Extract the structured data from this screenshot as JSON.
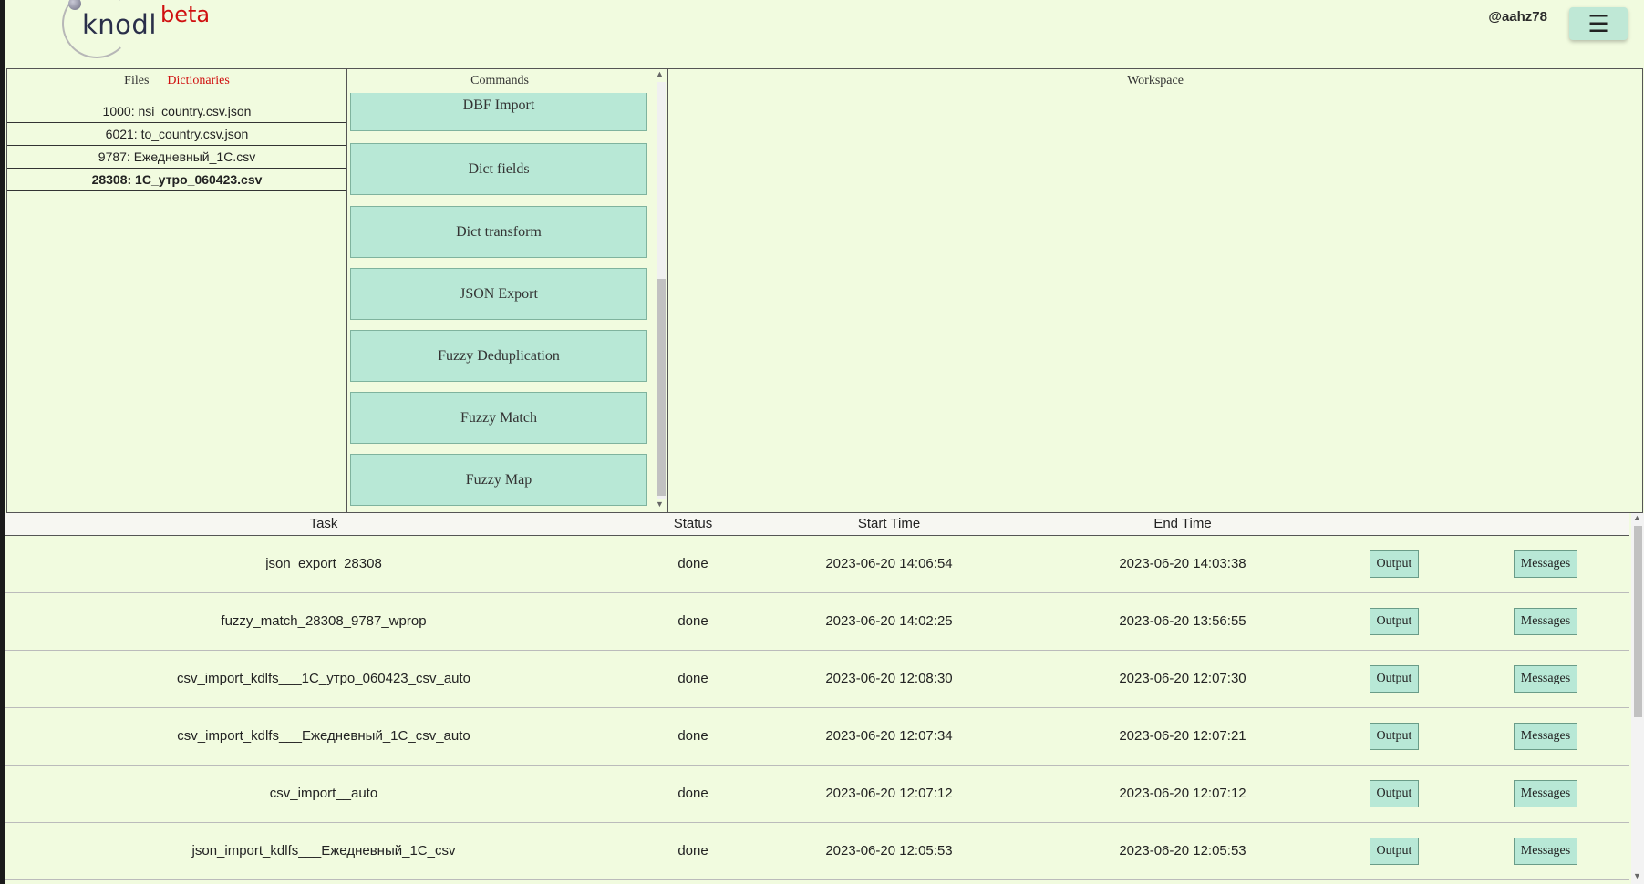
{
  "header": {
    "logo_text": "knodl",
    "badge": "beta",
    "username": "@aahz78",
    "menu_icon": "☰"
  },
  "files_panel": {
    "tabs": [
      {
        "label": "Files",
        "active": false
      },
      {
        "label": "Dictionaries",
        "active": true
      }
    ],
    "items": [
      {
        "label": "1000: nsi_country.csv.json"
      },
      {
        "label": "6021: to_country.csv.json"
      },
      {
        "label": "9787: Ежедневный_1C.csv"
      },
      {
        "label": "28308: 1C_утро_060423.csv",
        "selected": true
      }
    ]
  },
  "commands_panel": {
    "title": "Commands",
    "buttons": [
      "DBF Import",
      "Dict fields",
      "Dict transform",
      "JSON Export",
      "Fuzzy Deduplication",
      "Fuzzy Match",
      "Fuzzy Map"
    ]
  },
  "workspace_panel": {
    "title": "Workspace"
  },
  "tasks": {
    "columns": [
      "Task",
      "Status",
      "Start Time",
      "End Time"
    ],
    "output_label": "Output",
    "messages_label": "Messages",
    "rows": [
      {
        "task": "json_export_28308",
        "status": "done",
        "start": "2023-06-20 14:06:54",
        "end": "2023-06-20 14:03:38"
      },
      {
        "task": "fuzzy_match_28308_9787_wprop",
        "status": "done",
        "start": "2023-06-20 14:02:25",
        "end": "2023-06-20 13:56:55"
      },
      {
        "task": "csv_import_kdlfs___1C_утро_060423_csv_auto",
        "status": "done",
        "start": "2023-06-20 12:08:30",
        "end": "2023-06-20 12:07:30"
      },
      {
        "task": "csv_import_kdlfs___Ежедневный_1C_csv_auto",
        "status": "done",
        "start": "2023-06-20 12:07:34",
        "end": "2023-06-20 12:07:21"
      },
      {
        "task": "csv_import__auto",
        "status": "done",
        "start": "2023-06-20 12:07:12",
        "end": "2023-06-20 12:07:12"
      },
      {
        "task": "json_import_kdlfs___Ежедневный_1C_csv",
        "status": "done",
        "start": "2023-06-20 12:05:53",
        "end": "2023-06-20 12:05:53"
      }
    ]
  },
  "colors": {
    "background": "#f1fbdf",
    "button": "#b8e8d6",
    "accent_red": "#d01010"
  }
}
